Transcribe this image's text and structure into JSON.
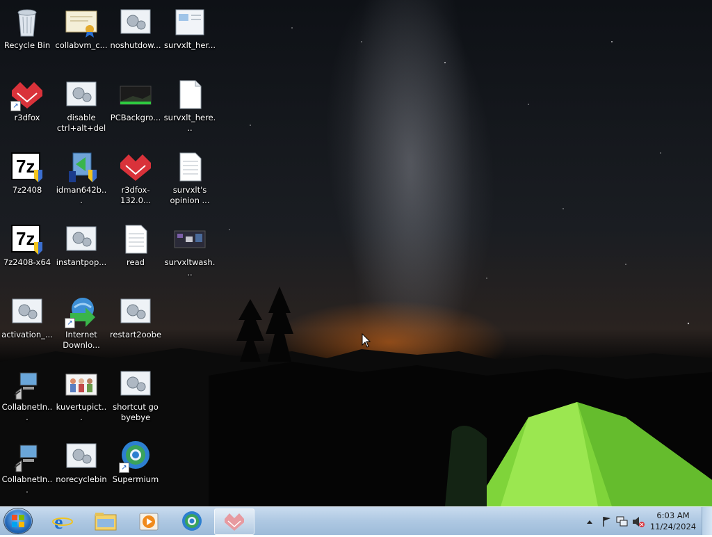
{
  "desktop": {
    "icons": [
      {
        "label": "Recycle Bin",
        "icon": "recycle-bin-icon"
      },
      {
        "label": "collabvm_c...",
        "icon": "certificate-icon"
      },
      {
        "label": "noshutdow...",
        "icon": "script-settings-icon"
      },
      {
        "label": "survxlt_her...",
        "icon": "document-icon"
      },
      {
        "label": "r3dfox",
        "icon": "r3dfox-icon"
      },
      {
        "label": "disable ctrl+alt+del",
        "icon": "script-settings-icon"
      },
      {
        "label": "PCBackgro...",
        "icon": "image-file-icon"
      },
      {
        "label": "survxlt_here...",
        "icon": "blank-file-icon"
      },
      {
        "label": "7z2408",
        "icon": "7zip-installer-icon"
      },
      {
        "label": "idman642b...",
        "icon": "installer-icon"
      },
      {
        "label": "r3dfox-132.0...",
        "icon": "r3dfox-icon"
      },
      {
        "label": "survxlt's opinion ...",
        "icon": "text-file-icon"
      },
      {
        "label": "7z2408-x64",
        "icon": "7zip-installer-icon"
      },
      {
        "label": "instantpop...",
        "icon": "script-settings-icon"
      },
      {
        "label": "read",
        "icon": "text-file-icon"
      },
      {
        "label": "survxltwash...",
        "icon": "image-file-icon"
      },
      {
        "label": "activation_...",
        "icon": "script-settings-icon"
      },
      {
        "label": "Internet Downlo...",
        "icon": "internet-download-manager-icon"
      },
      {
        "label": "restart2oobe",
        "icon": "script-settings-icon"
      },
      {
        "label": "CollabnetIn...",
        "icon": "network-computer-icon"
      },
      {
        "label": "kuvertupict...",
        "icon": "image-file-icon"
      },
      {
        "label": "shortcut go byebye",
        "icon": "script-settings-icon"
      },
      {
        "label": "CollabnetIn...",
        "icon": "network-computer-icon"
      },
      {
        "label": "norecyclebin",
        "icon": "script-settings-icon"
      },
      {
        "label": "Supermium",
        "icon": "supermium-browser-icon"
      }
    ]
  },
  "taskbar": {
    "start": "windows-start-orb-icon",
    "pinned": [
      {
        "name": "internet-explorer-icon"
      },
      {
        "name": "file-explorer-icon"
      },
      {
        "name": "media-player-icon"
      },
      {
        "name": "supermium-browser-icon"
      },
      {
        "name": "r3dfox-icon"
      }
    ],
    "tray": {
      "time": "6:03 AM",
      "date": "11/24/2024"
    }
  }
}
